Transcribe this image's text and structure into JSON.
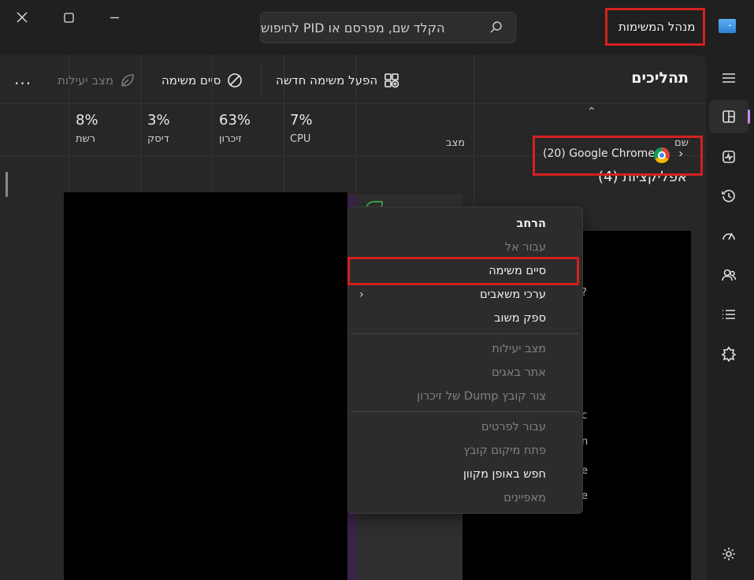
{
  "titlebar": {
    "app_title": "מנהל המשימות",
    "search_placeholder": "הקלד שם, מפרסם או PID לחיפוש",
    "icons": [
      "close-icon",
      "maximize-icon",
      "minimize-icon",
      "search-icon",
      "app-icon"
    ]
  },
  "toolbar": {
    "page_title": "תהליכים",
    "run_new_task": "הפעל משימה חדשה",
    "end_task": "סיים משימה",
    "efficiency_mode": "מצב יעילות",
    "more": "..."
  },
  "columns": {
    "name": "שם",
    "status": "מצב",
    "cpu": {
      "label": "CPU",
      "pct": "7%"
    },
    "memory": {
      "label": "זיכרון",
      "pct": "63%"
    },
    "disk": {
      "label": "דיסק",
      "pct": "3%"
    },
    "network": {
      "label": "רשת",
      "pct": "8%"
    }
  },
  "group": {
    "label": "אפליקציות (4)"
  },
  "row": {
    "name": "Google Chrome",
    "count": "(20)"
  },
  "context_menu": {
    "items": [
      {
        "label": "הרחב",
        "state": "bold"
      },
      {
        "label": "עבור אל",
        "state": "disabled"
      },
      {
        "label": "סיים משימה",
        "state": "normal"
      },
      {
        "label": "ערכי משאבים",
        "state": "normal",
        "submenu": true
      },
      {
        "label": "ספק משוב",
        "state": "normal"
      },
      {
        "label": "מצב יעילות",
        "state": "disabled"
      },
      {
        "label": "אתר באגים",
        "state": "disabled"
      },
      {
        "label": "צור קובץ Dump של זיכרון",
        "state": "disabled"
      },
      {
        "label": "עבור לפרטים",
        "state": "disabled"
      },
      {
        "label": "פתח מיקום קובץ",
        "state": "disabled"
      },
      {
        "label": "חפש באופן מקוון",
        "state": "normal"
      },
      {
        "label": "מאפיינים",
        "state": "disabled"
      }
    ]
  },
  "nav": [
    "hamburger-icon",
    "processes-icon",
    "performance-icon",
    "app-history-icon",
    "startup-icon",
    "users-icon",
    "details-icon",
    "services-icon",
    "settings-icon"
  ],
  "colors": {
    "highlight": "#d42020",
    "accent": "#c58af9"
  }
}
